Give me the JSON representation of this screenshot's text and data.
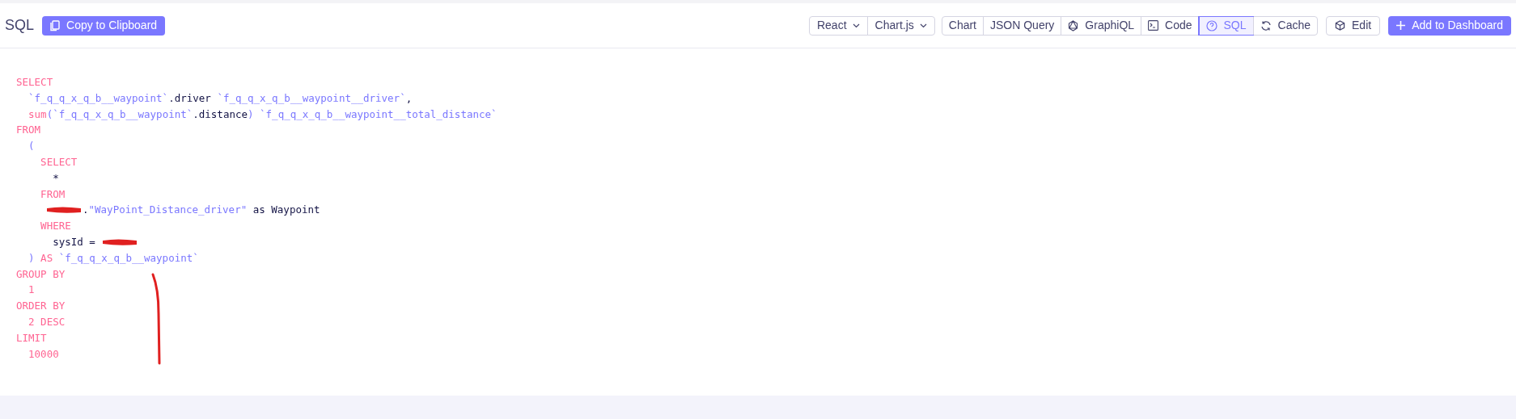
{
  "header": {
    "title": "SQL",
    "copy_button": "Copy to Clipboard"
  },
  "selectors": [
    {
      "label": "React"
    },
    {
      "label": "Chart.js"
    }
  ],
  "view_tabs": [
    {
      "label": "Chart",
      "kind": "plain",
      "selected": false
    },
    {
      "label": "JSON Query",
      "kind": "plain",
      "selected": false
    },
    {
      "label": "GraphiQL",
      "kind": "graphql",
      "selected": false
    },
    {
      "label": "Code",
      "kind": "code",
      "selected": false
    },
    {
      "label": "SQL",
      "kind": "sql",
      "selected": true
    },
    {
      "label": "Cache",
      "kind": "cache",
      "selected": false
    }
  ],
  "edit_button": "Edit",
  "add_button": "Add to Dashboard",
  "code_lines": [
    {
      "tokens": [
        {
          "kind": "keyword",
          "text": "SELECT"
        }
      ]
    },
    {
      "tokens": [
        {
          "kind": "ident",
          "text": "  `f_q_q_x_q_b__waypoint`"
        },
        {
          "kind": "plain",
          "text": ".driver "
        },
        {
          "kind": "ident",
          "text": "`f_q_q_x_q_b__waypoint__driver`"
        },
        {
          "kind": "plain",
          "text": ","
        }
      ]
    },
    {
      "tokens": [
        {
          "kind": "keyword",
          "text": "  sum"
        },
        {
          "kind": "ident",
          "text": "(`f_q_q_x_q_b__waypoint`"
        },
        {
          "kind": "plain",
          "text": ".distance"
        },
        {
          "kind": "ident",
          "text": ") `f_q_q_x_q_b__waypoint__total_distance`"
        }
      ]
    },
    {
      "tokens": [
        {
          "kind": "keyword",
          "text": "FROM"
        }
      ]
    },
    {
      "tokens": [
        {
          "kind": "ident",
          "text": "  ("
        }
      ]
    },
    {
      "tokens": [
        {
          "kind": "keyword",
          "text": "    SELECT"
        }
      ]
    },
    {
      "tokens": [
        {
          "kind": "plain",
          "text": "      *"
        }
      ]
    },
    {
      "tokens": [
        {
          "kind": "keyword",
          "text": "    FROM"
        }
      ]
    },
    {
      "tokens": [
        {
          "kind": "redaction"
        },
        {
          "kind": "plain",
          "text": "."
        },
        {
          "kind": "ident",
          "text": "\"WayPoint_Distance_driver\""
        },
        {
          "kind": "plain",
          "text": " as Waypoint"
        }
      ]
    },
    {
      "tokens": [
        {
          "kind": "keyword",
          "text": "    WHERE"
        }
      ]
    },
    {
      "tokens": [
        {
          "kind": "plain",
          "text": "      sysId = "
        },
        {
          "kind": "redaction"
        }
      ]
    },
    {
      "tokens": [
        {
          "kind": "ident",
          "text": "  )"
        },
        {
          "kind": "keyword",
          "text": " AS "
        },
        {
          "kind": "ident",
          "text": "`f_q_q_x_q_b__waypoint`"
        }
      ]
    },
    {
      "tokens": [
        {
          "kind": "keyword",
          "text": "GROUP BY"
        }
      ]
    },
    {
      "tokens": [
        {
          "kind": "keyword",
          "text": "  1"
        }
      ]
    },
    {
      "tokens": [
        {
          "kind": "keyword",
          "text": "ORDER BY"
        }
      ]
    },
    {
      "tokens": [
        {
          "kind": "keyword",
          "text": "  2 DESC"
        }
      ]
    },
    {
      "tokens": [
        {
          "kind": "keyword",
          "text": "LIMIT"
        }
      ]
    },
    {
      "tokens": [
        {
          "kind": "keyword",
          "text": "  10000"
        }
      ]
    }
  ]
}
